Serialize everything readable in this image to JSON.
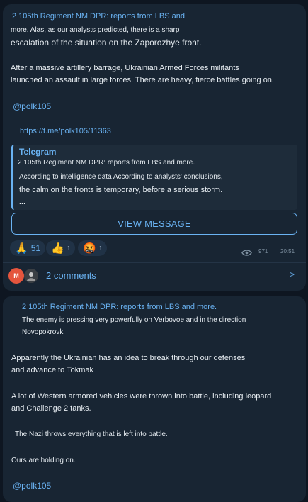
{
  "post1": {
    "author_line": "2 105th Regiment NM DPR: reports from LBS and",
    "line2": "more. Alas, as our analysts predicted, there is a sharp",
    "line3": "escalation of the situation on the Zaporozhye front.",
    "para2_line1": "After a massive artillery barrage, Ukrainian Armed Forces militants",
    "para2_line2": "launched an assault in large forces. There are heavy, fierce battles going on.",
    "handle": "@polk105",
    "url": "https://t.me/polk105/11363",
    "quote": {
      "title": "Telegram",
      "channel": "2 105th Regiment NM DPR: reports from LBS and more.",
      "line1": "According to intelligence data According to analysts' conclusions,",
      "line2": "the calm on the fronts is temporary, before a serious storm.",
      "ellipsis": "..."
    },
    "view_button": "VIEW MESSAGE",
    "reactions": [
      {
        "emoji": "🙏",
        "count": "51"
      },
      {
        "emoji": "👍",
        "count": "1"
      },
      {
        "emoji": "🤬",
        "count": "1"
      }
    ],
    "views": "971",
    "time": "20:51",
    "comments": {
      "label": "2 comments",
      "avatar_letter": "M",
      "arrow": ">"
    }
  },
  "post2": {
    "author_line": "2 105th Regiment NM DPR: reports from LBS and more.",
    "line1": "The enemy is pressing very powerfully on Verbovoe and in the direction",
    "line2": "Novopokrovki",
    "para2_line1": "Apparently the Ukrainian has an idea to break through our defenses",
    "para2_line2": "and advance to Tokmak",
    "para3_line1": "A lot of Western armored vehicles were thrown into battle, including leopard",
    "para3_line2": "and Challenge 2 tanks.",
    "para4": "The Nazi throws everything that is left into battle.",
    "para5": "Ours are holding on.",
    "handle": "@polk105"
  },
  "colors": {
    "background": "#0e1621",
    "card": "#182533",
    "accent": "#6ab3f3",
    "text": "#e6ecf1",
    "muted": "#7d8f9f",
    "avatar_m": "#e5553d"
  }
}
